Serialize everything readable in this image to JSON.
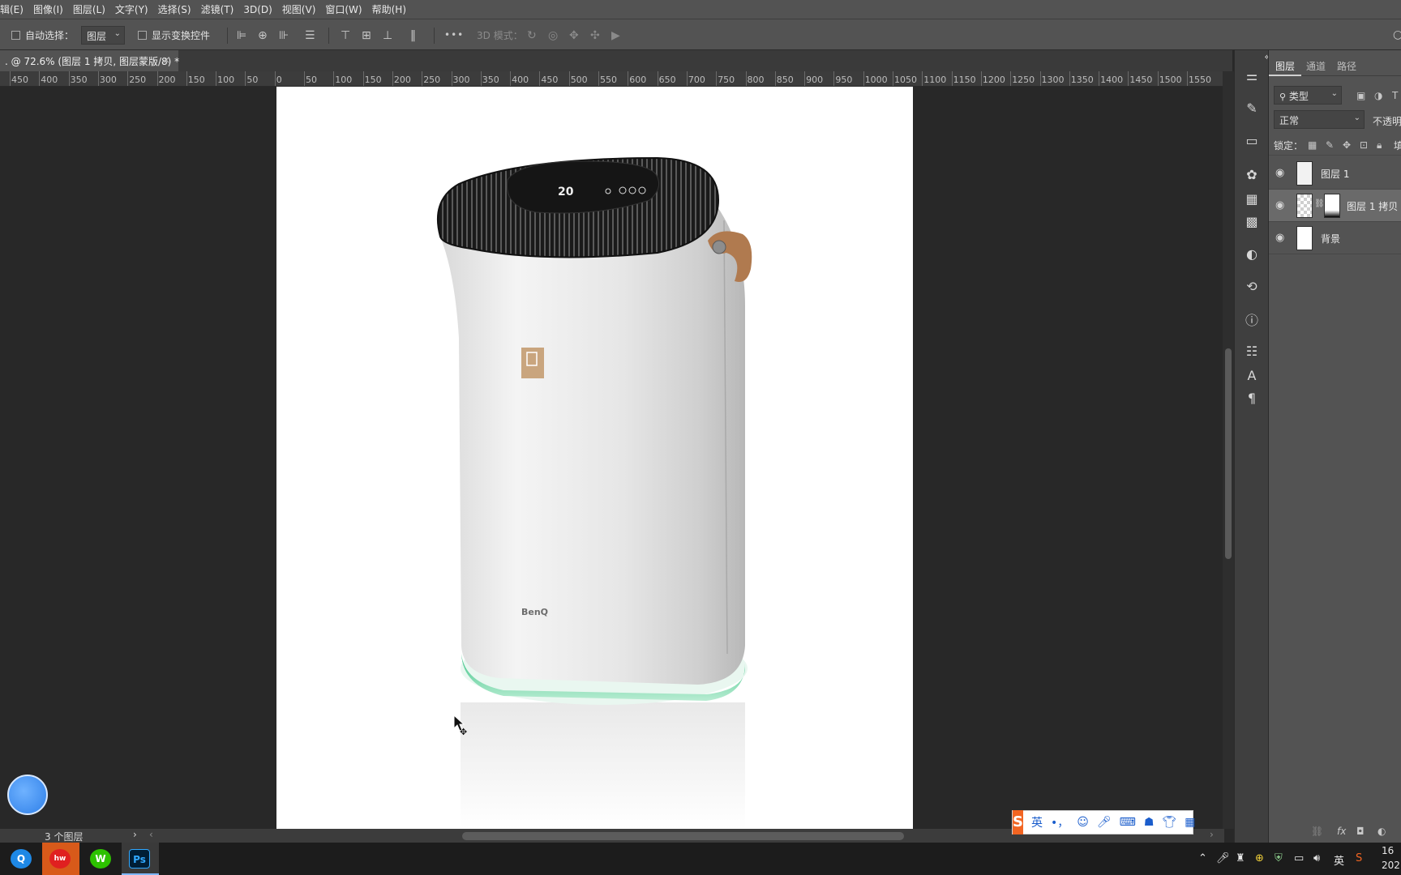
{
  "menu": [
    "辑(E)",
    "图像(I)",
    "图层(L)",
    "文字(Y)",
    "选择(S)",
    "滤镜(T)",
    "3D(D)",
    "视图(V)",
    "窗口(W)",
    "帮助(H)"
  ],
  "options": {
    "auto_select_label": "自动选择：",
    "auto_select_value": "图层",
    "show_transform_label": "显示变换控件",
    "more": "•••",
    "mode3d_label": "3D 模式："
  },
  "doc_tab": {
    "title": ". @ 72.6% (图层 1 拷贝, 图层蒙版/8) *",
    "close": "×"
  },
  "ruler": [
    "450",
    "400",
    "350",
    "300",
    "250",
    "200",
    "150",
    "100",
    "50",
    "0",
    "50",
    "100",
    "150",
    "200",
    "250",
    "300",
    "350",
    "400",
    "450",
    "500",
    "550",
    "600",
    "650",
    "700",
    "750",
    "800",
    "850",
    "900",
    "950",
    "1000",
    "1050",
    "1100",
    "1150",
    "1200",
    "1250",
    "1300",
    "1350",
    "1400",
    "1450",
    "1500",
    "1550"
  ],
  "product": {
    "brand": "BenQ",
    "display_value": "20"
  },
  "status": {
    "layer_count": "3 个图层",
    "arrow": "›",
    "scroll_left": "‹",
    "scroll_right": "›"
  },
  "panel": {
    "tabs": [
      "图层",
      "通道",
      "路径"
    ],
    "filter_kind": "类型",
    "blend_mode": "正常",
    "opacity_label": "不透明",
    "lock_label": "锁定：",
    "fill_label": "填",
    "layers": [
      {
        "name": "图层 1",
        "selected": false
      },
      {
        "name": "图层 1 拷贝",
        "selected": true
      },
      {
        "name": "背景",
        "selected": false
      }
    ],
    "footer_link": "⛓",
    "footer_fx": "fx"
  },
  "ime": {
    "logo": "S",
    "lang": "英",
    "punct": "•，"
  },
  "taskbar": {
    "apps": [
      "Q",
      "hw",
      "W",
      "Ps"
    ],
    "tray_lang": "英",
    "time": "16",
    "date": "202"
  },
  "colors": {
    "ps_accent": "#31a8ff",
    "panel_bg": "#535353",
    "canvas_bg": "#282828",
    "strap_brown": "#b07a4f",
    "base_green": "#3fc487"
  }
}
